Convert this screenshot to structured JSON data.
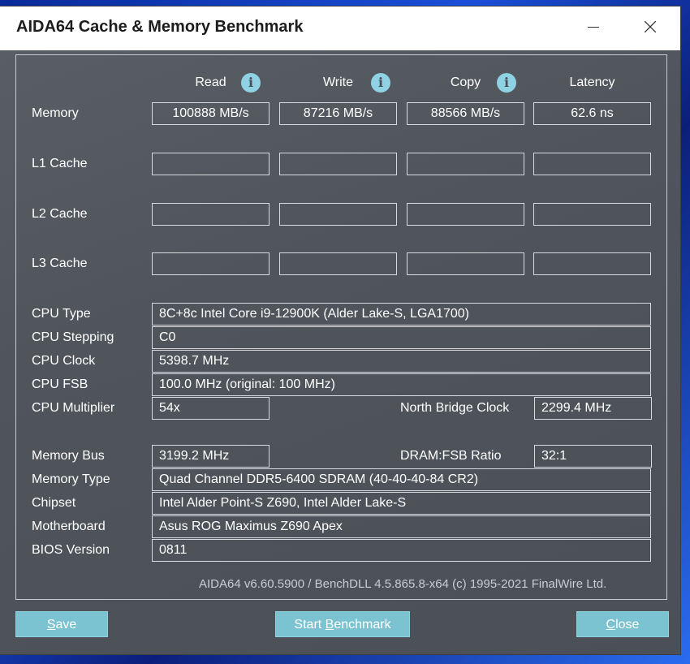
{
  "window": {
    "title": "AIDA64 Cache & Memory Benchmark"
  },
  "columns": {
    "read": "Read",
    "write": "Write",
    "copy": "Copy",
    "latency": "Latency"
  },
  "rows": {
    "memory": {
      "label": "Memory",
      "read": "100888 MB/s",
      "write": "87216 MB/s",
      "copy": "88566 MB/s",
      "latency": "62.6 ns"
    },
    "l1": {
      "label": "L1 Cache",
      "read": "",
      "write": "",
      "copy": "",
      "latency": ""
    },
    "l2": {
      "label": "L2 Cache",
      "read": "",
      "write": "",
      "copy": "",
      "latency": ""
    },
    "l3": {
      "label": "L3 Cache",
      "read": "",
      "write": "",
      "copy": "",
      "latency": ""
    }
  },
  "cpu": {
    "type_label": "CPU Type",
    "type": "8C+8c Intel Core i9-12900K  (Alder Lake-S, LGA1700)",
    "stepping_label": "CPU Stepping",
    "stepping": "C0",
    "clock_label": "CPU Clock",
    "clock": "5398.7 MHz",
    "fsb_label": "CPU FSB",
    "fsb": "100.0 MHz  (original: 100 MHz)",
    "multiplier_label": "CPU Multiplier",
    "multiplier": "54x",
    "nb_clock_label": "North Bridge Clock",
    "nb_clock": "2299.4 MHz"
  },
  "memory_info": {
    "bus_label": "Memory Bus",
    "bus": "3199.2 MHz",
    "dram_ratio_label": "DRAM:FSB Ratio",
    "dram_ratio": "32:1",
    "type_label": "Memory Type",
    "type": "Quad Channel DDR5-6400 SDRAM  (40-40-40-84 CR2)",
    "chipset_label": "Chipset",
    "chipset": "Intel Alder Point-S Z690, Intel Alder Lake-S",
    "motherboard_label": "Motherboard",
    "motherboard": "Asus ROG Maximus Z690 Apex",
    "bios_label": "BIOS Version",
    "bios": "0811"
  },
  "footer": {
    "version_text": "AIDA64 v6.60.5900 / BenchDLL 4.5.865.8-x64  (c) 1995-2021 FinalWire Ltd."
  },
  "buttons": {
    "save_mnemonic": "S",
    "save_rest": "ave",
    "start_prefix": "Start ",
    "start_mnemonic": "B",
    "start_rest": "enchmark",
    "close_mnemonic": "C",
    "close_rest": "lose"
  },
  "icons": {
    "info": "info-icon",
    "close": "close-icon",
    "minimize": "minimize-icon"
  },
  "colors": {
    "window_bg": "#50555c",
    "button_bg": "#7cc3d2",
    "info_icon": "#8fd2e4"
  }
}
